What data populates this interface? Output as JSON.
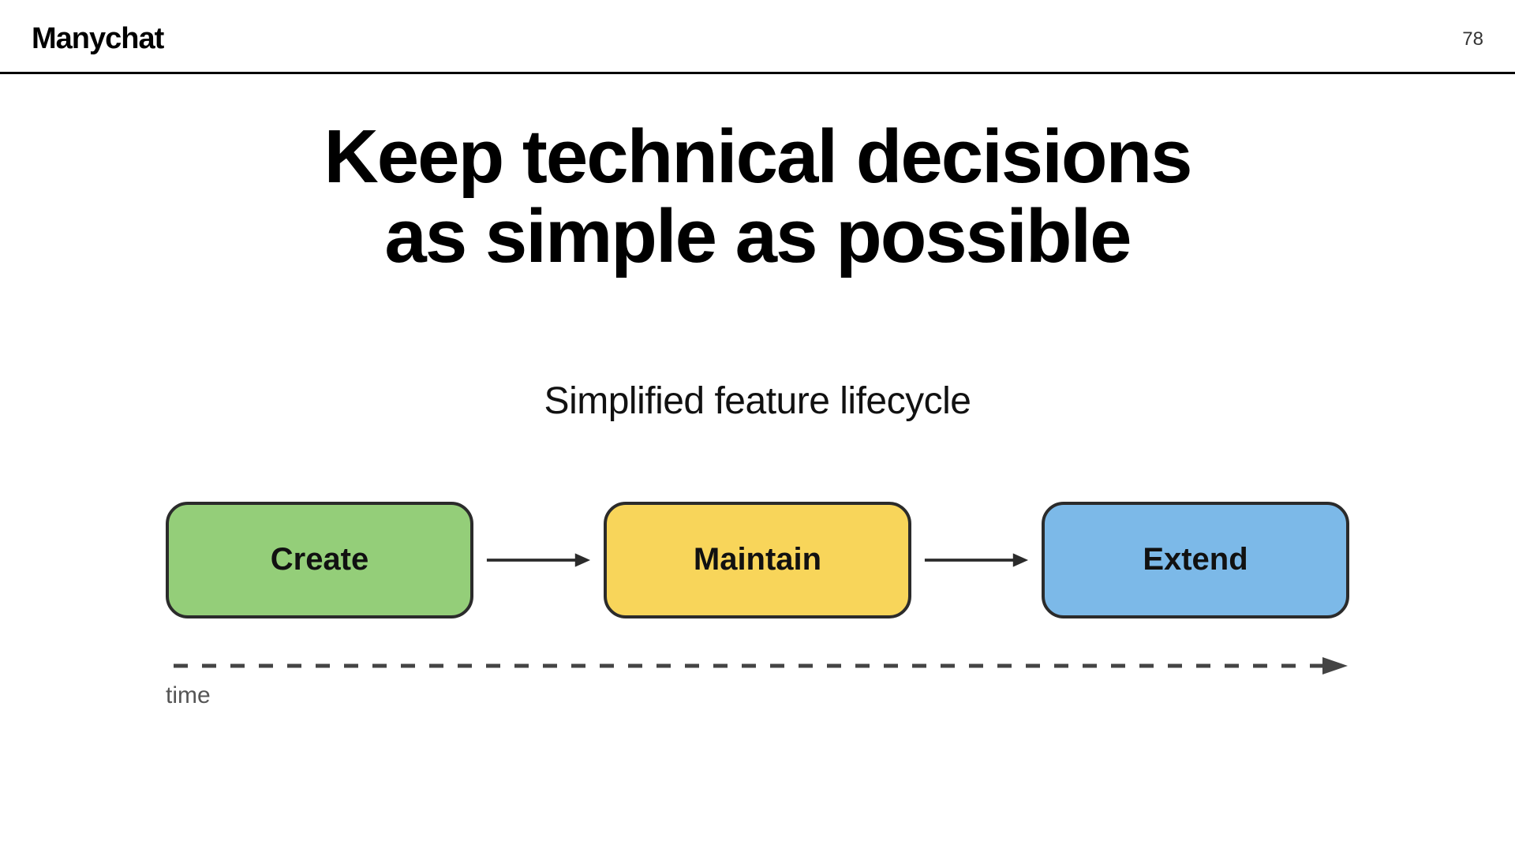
{
  "header": {
    "logo": "Manychat",
    "page_number": "78"
  },
  "title_line1": "Keep technical decisions",
  "title_line2": "as simple as possible",
  "subtitle": "Simplified feature lifecycle",
  "diagram": {
    "boxes": {
      "create": "Create",
      "maintain": "Maintain",
      "extend": "Extend"
    },
    "axis_label": "time"
  },
  "colors": {
    "create": "#94ce79",
    "maintain": "#f8d55a",
    "extend": "#7cb9e8",
    "border": "#2b2b2b"
  }
}
